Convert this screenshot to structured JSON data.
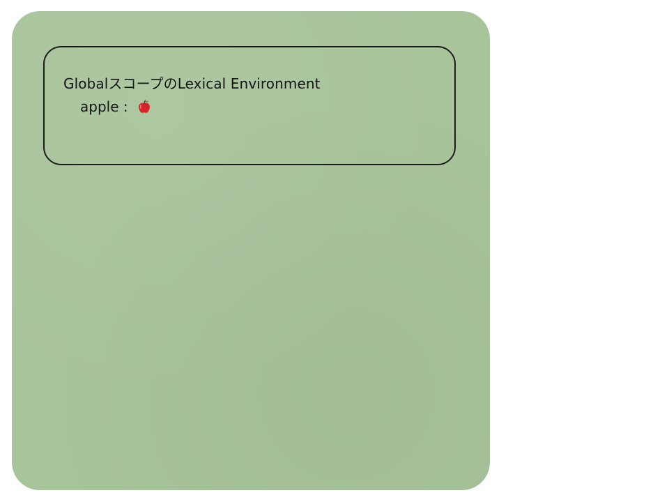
{
  "diagram": {
    "scope_title": "GlobalスコープのLexical Environment",
    "binding": {
      "name": "apple",
      "separator": " : ",
      "value_icon": "apple-icon"
    }
  },
  "colors": {
    "card_background": "#a8c49b",
    "box_border": "#1c1c1c",
    "text": "#141414",
    "apple_red": "#d8232a"
  }
}
